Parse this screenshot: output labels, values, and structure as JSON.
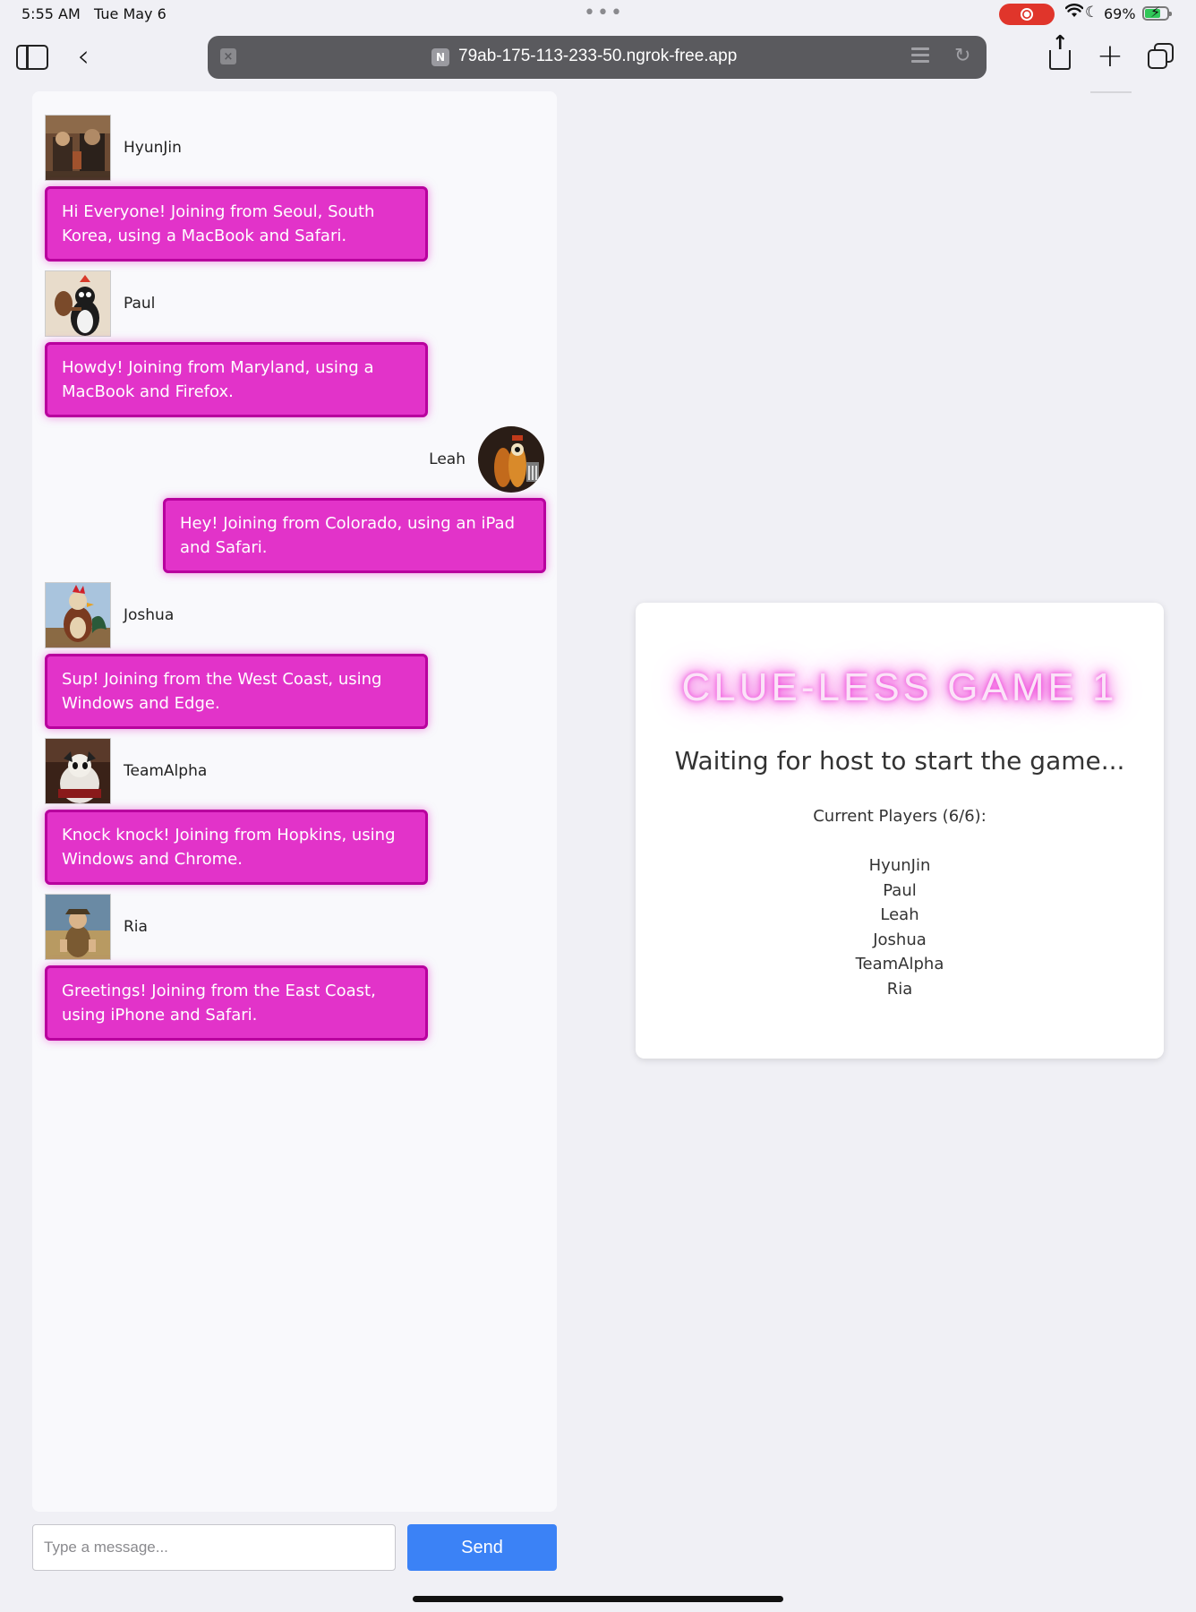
{
  "status_bar": {
    "time": "5:55 AM",
    "date": "Tue May 6",
    "battery": "69%",
    "battery_level": 0.69
  },
  "browser": {
    "url": "79ab-175-113-233-50.ngrok-free.app",
    "favicon_letter": "N"
  },
  "chat": {
    "messages": [
      {
        "name": "HyunJin",
        "text": "Hi Everyone! Joining from Seoul, South Korea, using a MacBook and Safari.",
        "own": false
      },
      {
        "name": "Paul",
        "text": "Howdy! Joining from Maryland, using a MacBook and Firefox.",
        "own": false
      },
      {
        "name": "Leah",
        "text": "Hey! Joining from Colorado, using an iPad and Safari.",
        "own": true
      },
      {
        "name": "Joshua",
        "text": "Sup! Joining from the West Coast, using Windows and Edge.",
        "own": false
      },
      {
        "name": "TeamAlpha",
        "text": "Knock knock! Joining from Hopkins, using Windows and Chrome.",
        "own": false
      },
      {
        "name": "Ria",
        "text": "Greetings! Joining from the East Coast, using iPhone and Safari.",
        "own": false
      }
    ],
    "input_placeholder": "Type a message...",
    "input_value": "",
    "send_label": "Send"
  },
  "game": {
    "title": "CLUE-LESS GAME 1",
    "subtitle": "Waiting for host to start the game...",
    "players_label": "Current Players (6/6):",
    "players": [
      "HyunJin",
      "Paul",
      "Leah",
      "Joshua",
      "TeamAlpha",
      "Ria"
    ]
  },
  "colors": {
    "bubble": "#e233c9",
    "bubble_border": "#b8009e",
    "send_button": "#3b82f6",
    "title_glow": "#ee3fd8"
  }
}
